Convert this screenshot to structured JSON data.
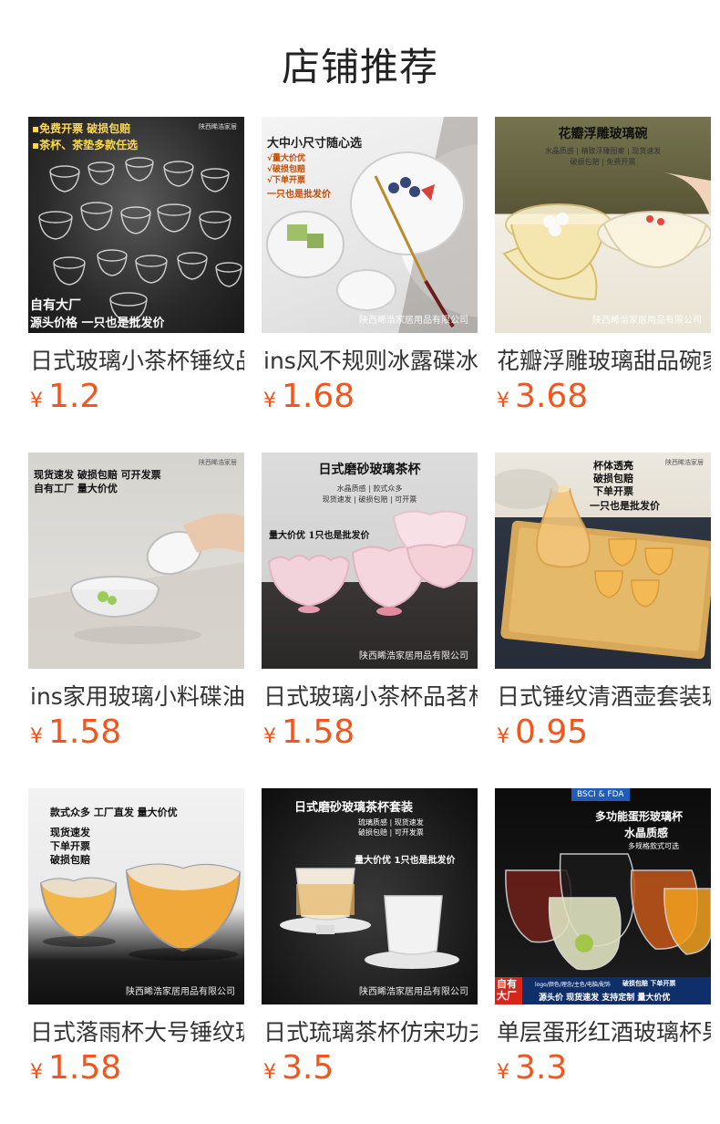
{
  "page": {
    "title": "店铺推荐"
  },
  "products": [
    {
      "name": "日式玻璃小茶杯锤纹品茗杯",
      "currency": "¥",
      "price": "1.2",
      "overlay": {
        "lines": [
          "▪免费开票 破损包赔",
          "▪茶杯、茶垫多款任选"
        ],
        "bottom": [
          "自有大厂",
          "源头价格 一只也是批发价"
        ],
        "brand": "陕西睎浩家居"
      }
    },
    {
      "name": "ins风不规则冰露碟冰川纹玻璃盘",
      "currency": "¥",
      "price": "1.68",
      "overlay": {
        "lines": [
          "大中小尺寸随心选",
          "√量大价优",
          "√破损包赔",
          "√下单开票",
          "一只也是批发价"
        ],
        "watermark": "陕西睎浩家居用品有限公司"
      }
    },
    {
      "name": "花瓣浮雕玻璃甜品碗家用沙拉碗",
      "currency": "¥",
      "price": "3.68",
      "overlay": {
        "lines": [
          "花瓣浮雕玻璃碗",
          "水晶质感 | 精致浮雕图案 | 现货速发",
          "破损包赔 | 免费开票"
        ],
        "watermark": "陕西睎浩家居用品有限公司"
      }
    },
    {
      "name": "ins家用玻璃小料碟油碟调味碟",
      "currency": "¥",
      "price": "1.58",
      "overlay": {
        "lines": [
          "现货速发 破损包赔 可开发票",
          "自有工厂 量大价优"
        ],
        "brand": "陕西睎浩家居"
      }
    },
    {
      "name": "日式玻璃小茶杯品茗杯功夫茶杯",
      "currency": "¥",
      "price": "1.58",
      "overlay": {
        "lines": [
          "日式磨砂玻璃茶杯",
          "水晶质感 | 款式众多",
          "现货速发 | 破损包赔 | 可开票",
          "量大价优 1只也是批发价"
        ],
        "watermark": "陕西睎浩家居用品有限公司"
      }
    },
    {
      "name": "日式锤纹清酒壶套装玻璃分酒器",
      "currency": "¥",
      "price": "0.95",
      "overlay": {
        "lines": [
          "杯体透亮",
          "破损包赔",
          "下单开票",
          "一只也是批发价"
        ],
        "brand": "陕西睎浩家居"
      }
    },
    {
      "name": "日式落雨杯大号锤纹玻璃茶杯",
      "currency": "¥",
      "price": "1.58",
      "overlay": {
        "lines": [
          "款式众多 工厂直发 量大价优",
          "现货速发",
          "下单开票",
          "破损包赔"
        ],
        "watermark": "陕西睎浩家居用品有限公司"
      }
    },
    {
      "name": "日式琉璃茶杯仿宋功夫茶具套装",
      "currency": "¥",
      "price": "3.5",
      "overlay": {
        "lines": [
          "日式磨砂玻璃茶杯套装",
          "琉璃质感 | 现货速发",
          "破损包赔 | 可开发票",
          "量大价优 1只也是批发价"
        ],
        "watermark": "陕西睎浩家居用品有限公司"
      }
    },
    {
      "name": "单层蛋形红酒玻璃杯果汁杯",
      "currency": "¥",
      "price": "3.3",
      "overlay": {
        "badge": "BSCI & FDA",
        "lines": [
          "多功能蛋形玻璃杯",
          "水晶质感",
          "多规格款式可选"
        ],
        "bottom": [
          "自有",
          "大厂",
          "logo/颜色/理念/主色/电脑/配饰",
          "破损包赔 下单开票",
          "源头价 现货速发 支持定制 量大价优"
        ]
      }
    }
  ]
}
